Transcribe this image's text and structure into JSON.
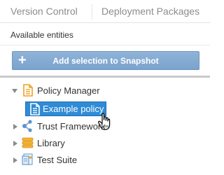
{
  "tabs": [
    {
      "label": "Version Control"
    },
    {
      "label": "Deployment Packages"
    }
  ],
  "section_label": "Available entities",
  "add_button": {
    "icon": "+",
    "label": "Add selection to Snapshot"
  },
  "tree": {
    "items": [
      {
        "label": "Policy Manager",
        "icon": "document-icon",
        "state": "expanded"
      },
      {
        "label": "Example policy",
        "icon": "document-icon",
        "state": "selected"
      },
      {
        "label": "Trust Framework",
        "icon": "share-icon",
        "state": "collapsed"
      },
      {
        "label": "Library",
        "icon": "stack-icon",
        "state": "collapsed"
      },
      {
        "label": "Test Suite",
        "icon": "test-suite-icon",
        "state": "collapsed"
      }
    ]
  },
  "colors": {
    "accent": "#2f8bd6",
    "button": "#7ba3cd",
    "icon_orange": "#f0a020"
  }
}
